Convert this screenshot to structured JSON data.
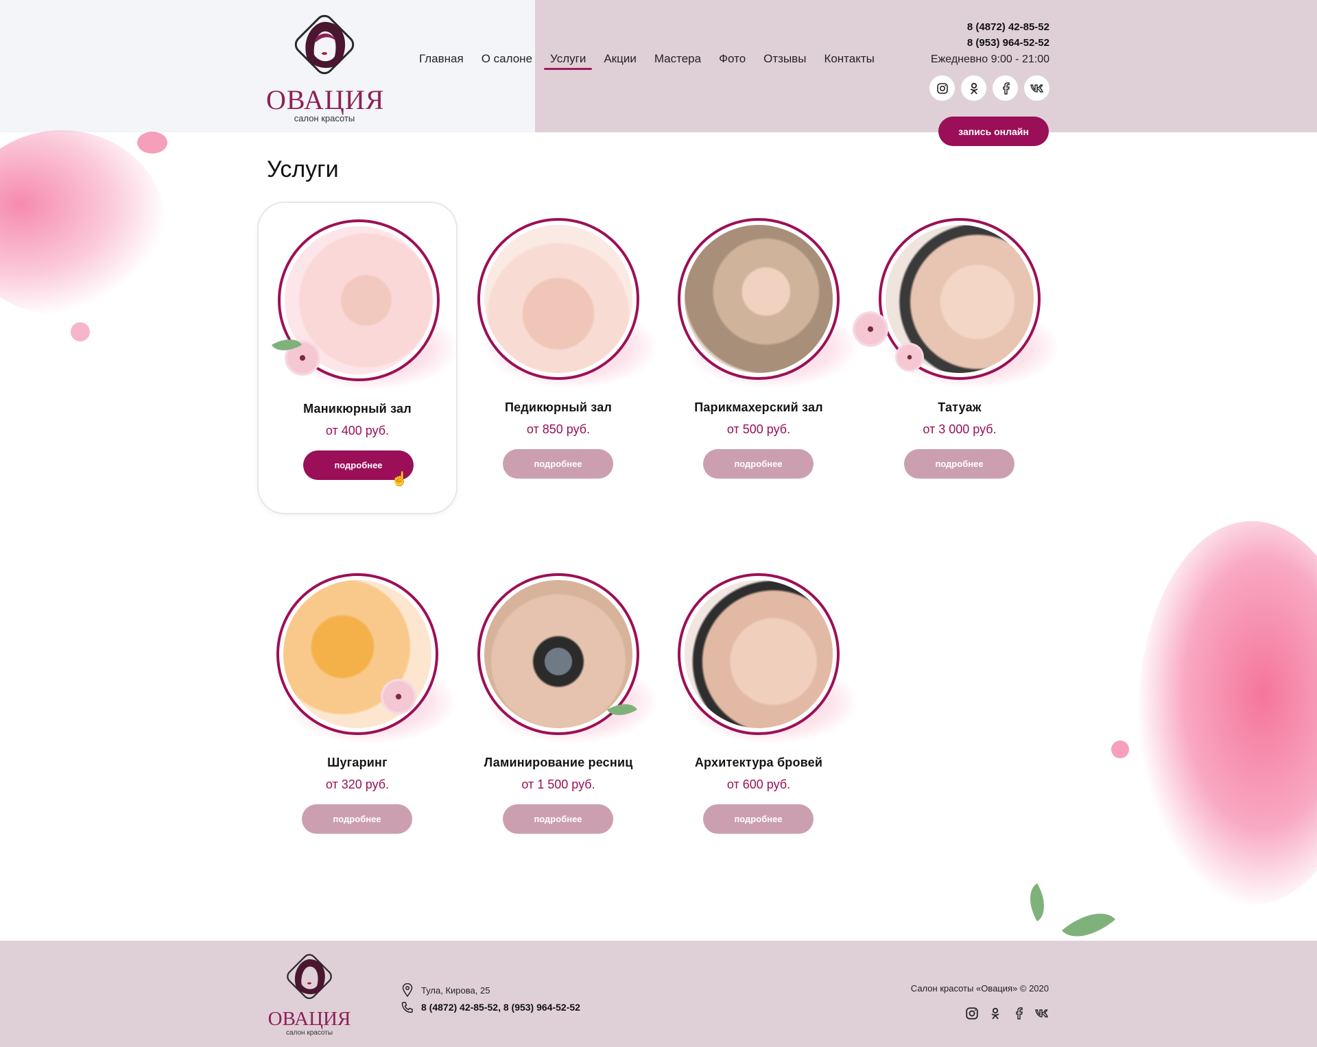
{
  "brand": {
    "name": "ОВАЦИЯ",
    "tagline": "салон красоты"
  },
  "nav": [
    {
      "label": "Главная"
    },
    {
      "label": "О салоне"
    },
    {
      "label": "Услуги"
    },
    {
      "label": "Акции"
    },
    {
      "label": "Мастера"
    },
    {
      "label": "Фото"
    },
    {
      "label": "Отзывы"
    },
    {
      "label": "Контакты"
    }
  ],
  "nav_active": "Услуги",
  "contacts": {
    "phone1": "8 (4872) 42-85-52",
    "phone2": "8 (953) 964-52-52",
    "hours": "Ежедневно 9:00 - 21:00"
  },
  "socials": [
    "instagram-icon",
    "odnoklassniki-icon",
    "facebook-icon",
    "vk-icon"
  ],
  "book_button": "запись онлайн",
  "page_title": "Услуги",
  "services": [
    {
      "name": "Маникюрный зал",
      "price": "от 400 руб.",
      "button": "подробнее",
      "active": true
    },
    {
      "name": "Педикюрный зал",
      "price": "от 850 руб.",
      "button": "подробнее",
      "active": false
    },
    {
      "name": "Парикмахерский зал",
      "price": "от 500 руб.",
      "button": "подробнее",
      "active": false
    },
    {
      "name": "Татуаж",
      "price": "от 3 000 руб.",
      "button": "подробнее",
      "active": false
    },
    {
      "name": "Шугаринг",
      "price": "от 320 руб.",
      "button": "подробнее",
      "active": false
    },
    {
      "name": "Ламинирование ресниц",
      "price": "от 1 500 руб.",
      "button": "подробнее",
      "active": false
    },
    {
      "name": "Архитектура бровей",
      "price": "от 600 руб.",
      "button": "подробнее",
      "active": false
    }
  ],
  "footer": {
    "address": "Тула, Кирова, 25",
    "phones": "8 (4872) 42-85-52, 8 (953) 964-52-52",
    "copyright": "Салон красоты «Овация» © 2020"
  },
  "colors": {
    "accent": "#9a0f57",
    "button_muted": "#cc9fb0",
    "header_bg": "#dfd0d7",
    "header_left_bg": "#f3f5f8"
  }
}
